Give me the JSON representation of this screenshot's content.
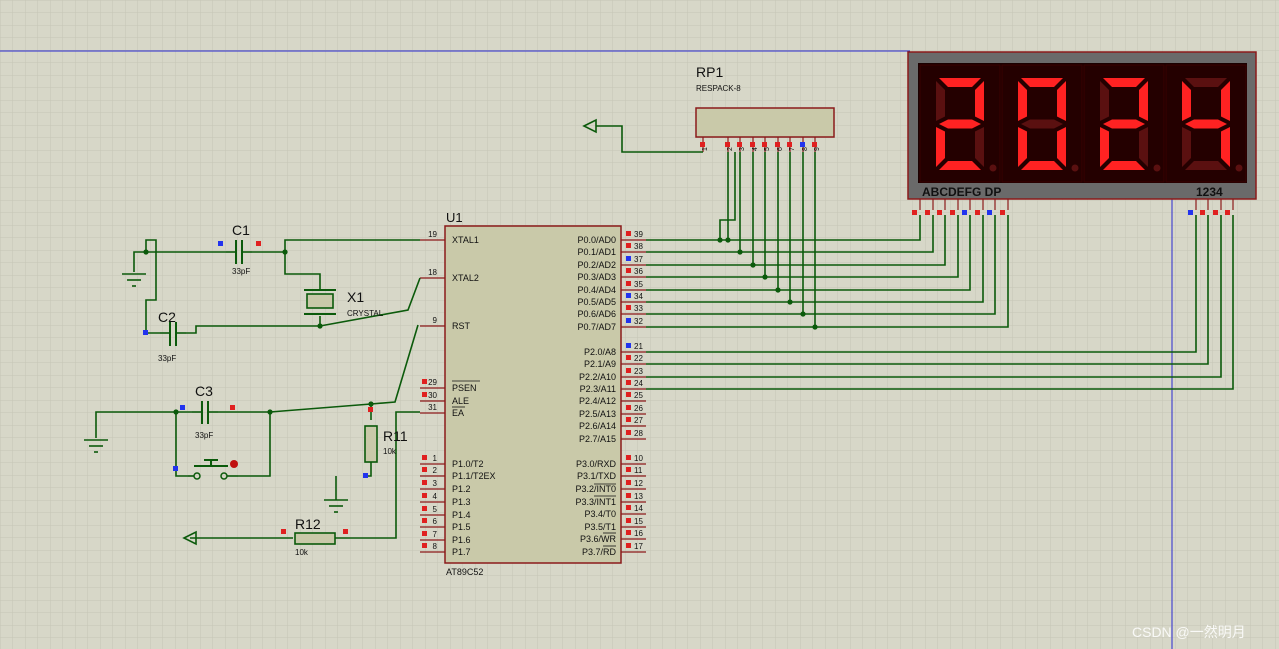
{
  "schematic": {
    "mcu": {
      "ref": "U1",
      "part": "AT89C52",
      "left_pins": [
        {
          "num": "19",
          "name": "XTAL1"
        },
        {
          "num": "18",
          "name": "XTAL2"
        },
        {
          "num": "9",
          "name": "RST"
        },
        {
          "num": "29",
          "name": "PSEN"
        },
        {
          "num": "30",
          "name": "ALE"
        },
        {
          "num": "31",
          "name": "EA"
        },
        {
          "num": "1",
          "name": "P1.0/T2"
        },
        {
          "num": "2",
          "name": "P1.1/T2EX"
        },
        {
          "num": "3",
          "name": "P1.2"
        },
        {
          "num": "4",
          "name": "P1.3"
        },
        {
          "num": "5",
          "name": "P1.4"
        },
        {
          "num": "6",
          "name": "P1.5"
        },
        {
          "num": "7",
          "name": "P1.6"
        },
        {
          "num": "8",
          "name": "P1.7"
        }
      ],
      "right_pins": [
        {
          "num": "39",
          "name": "P0.0/AD0"
        },
        {
          "num": "38",
          "name": "P0.1/AD1"
        },
        {
          "num": "37",
          "name": "P0.2/AD2"
        },
        {
          "num": "36",
          "name": "P0.3/AD3"
        },
        {
          "num": "35",
          "name": "P0.4/AD4"
        },
        {
          "num": "34",
          "name": "P0.5/AD5"
        },
        {
          "num": "33",
          "name": "P0.6/AD6"
        },
        {
          "num": "32",
          "name": "P0.7/AD7"
        },
        {
          "num": "21",
          "name": "P2.0/A8"
        },
        {
          "num": "22",
          "name": "P2.1/A9"
        },
        {
          "num": "23",
          "name": "P2.2/A10"
        },
        {
          "num": "24",
          "name": "P2.3/A11"
        },
        {
          "num": "25",
          "name": "P2.4/A12"
        },
        {
          "num": "26",
          "name": "P2.5/A13"
        },
        {
          "num": "27",
          "name": "P2.6/A14"
        },
        {
          "num": "28",
          "name": "P2.7/A15"
        },
        {
          "num": "10",
          "name": "P3.0/RXD"
        },
        {
          "num": "11",
          "name": "P3.1/TXD"
        },
        {
          "num": "12",
          "name": "P3.2/INT0"
        },
        {
          "num": "13",
          "name": "P3.3/INT1"
        },
        {
          "num": "14",
          "name": "P3.4/T0"
        },
        {
          "num": "15",
          "name": "P3.5/T1"
        },
        {
          "num": "16",
          "name": "P3.6/WR"
        },
        {
          "num": "17",
          "name": "P3.7/RD"
        }
      ]
    },
    "rp1": {
      "ref": "RP1",
      "part": "RESPACK-8",
      "pins": [
        "1",
        "2",
        "3",
        "4",
        "5",
        "6",
        "7",
        "8",
        "9"
      ]
    },
    "c1": {
      "ref": "C1",
      "value": "33pF"
    },
    "c2": {
      "ref": "C2",
      "value": "33pF"
    },
    "c3": {
      "ref": "C3",
      "value": "33pF"
    },
    "x1": {
      "ref": "X1",
      "value": "CRYSTAL"
    },
    "r11": {
      "ref": "R11",
      "value": "10k"
    },
    "r12": {
      "ref": "R12",
      "value": "10k"
    },
    "display": {
      "digits": "2024",
      "segment_label": "ABCDEFG DP",
      "digit_label": "1234",
      "on_color": "#ff2222",
      "off_color": "#5a1010"
    },
    "watermark": "CSDN @一然明月"
  },
  "colors": {
    "background": "#d7d7c8",
    "grid": "#c8c8b8",
    "wire": "#0b5a0b",
    "body_outline": "#8b1a1a",
    "body_fill": "#c9c9a9",
    "pin_red": "#e02020",
    "pin_blue": "#2233ee",
    "guide_line": "#2a2ad0"
  }
}
